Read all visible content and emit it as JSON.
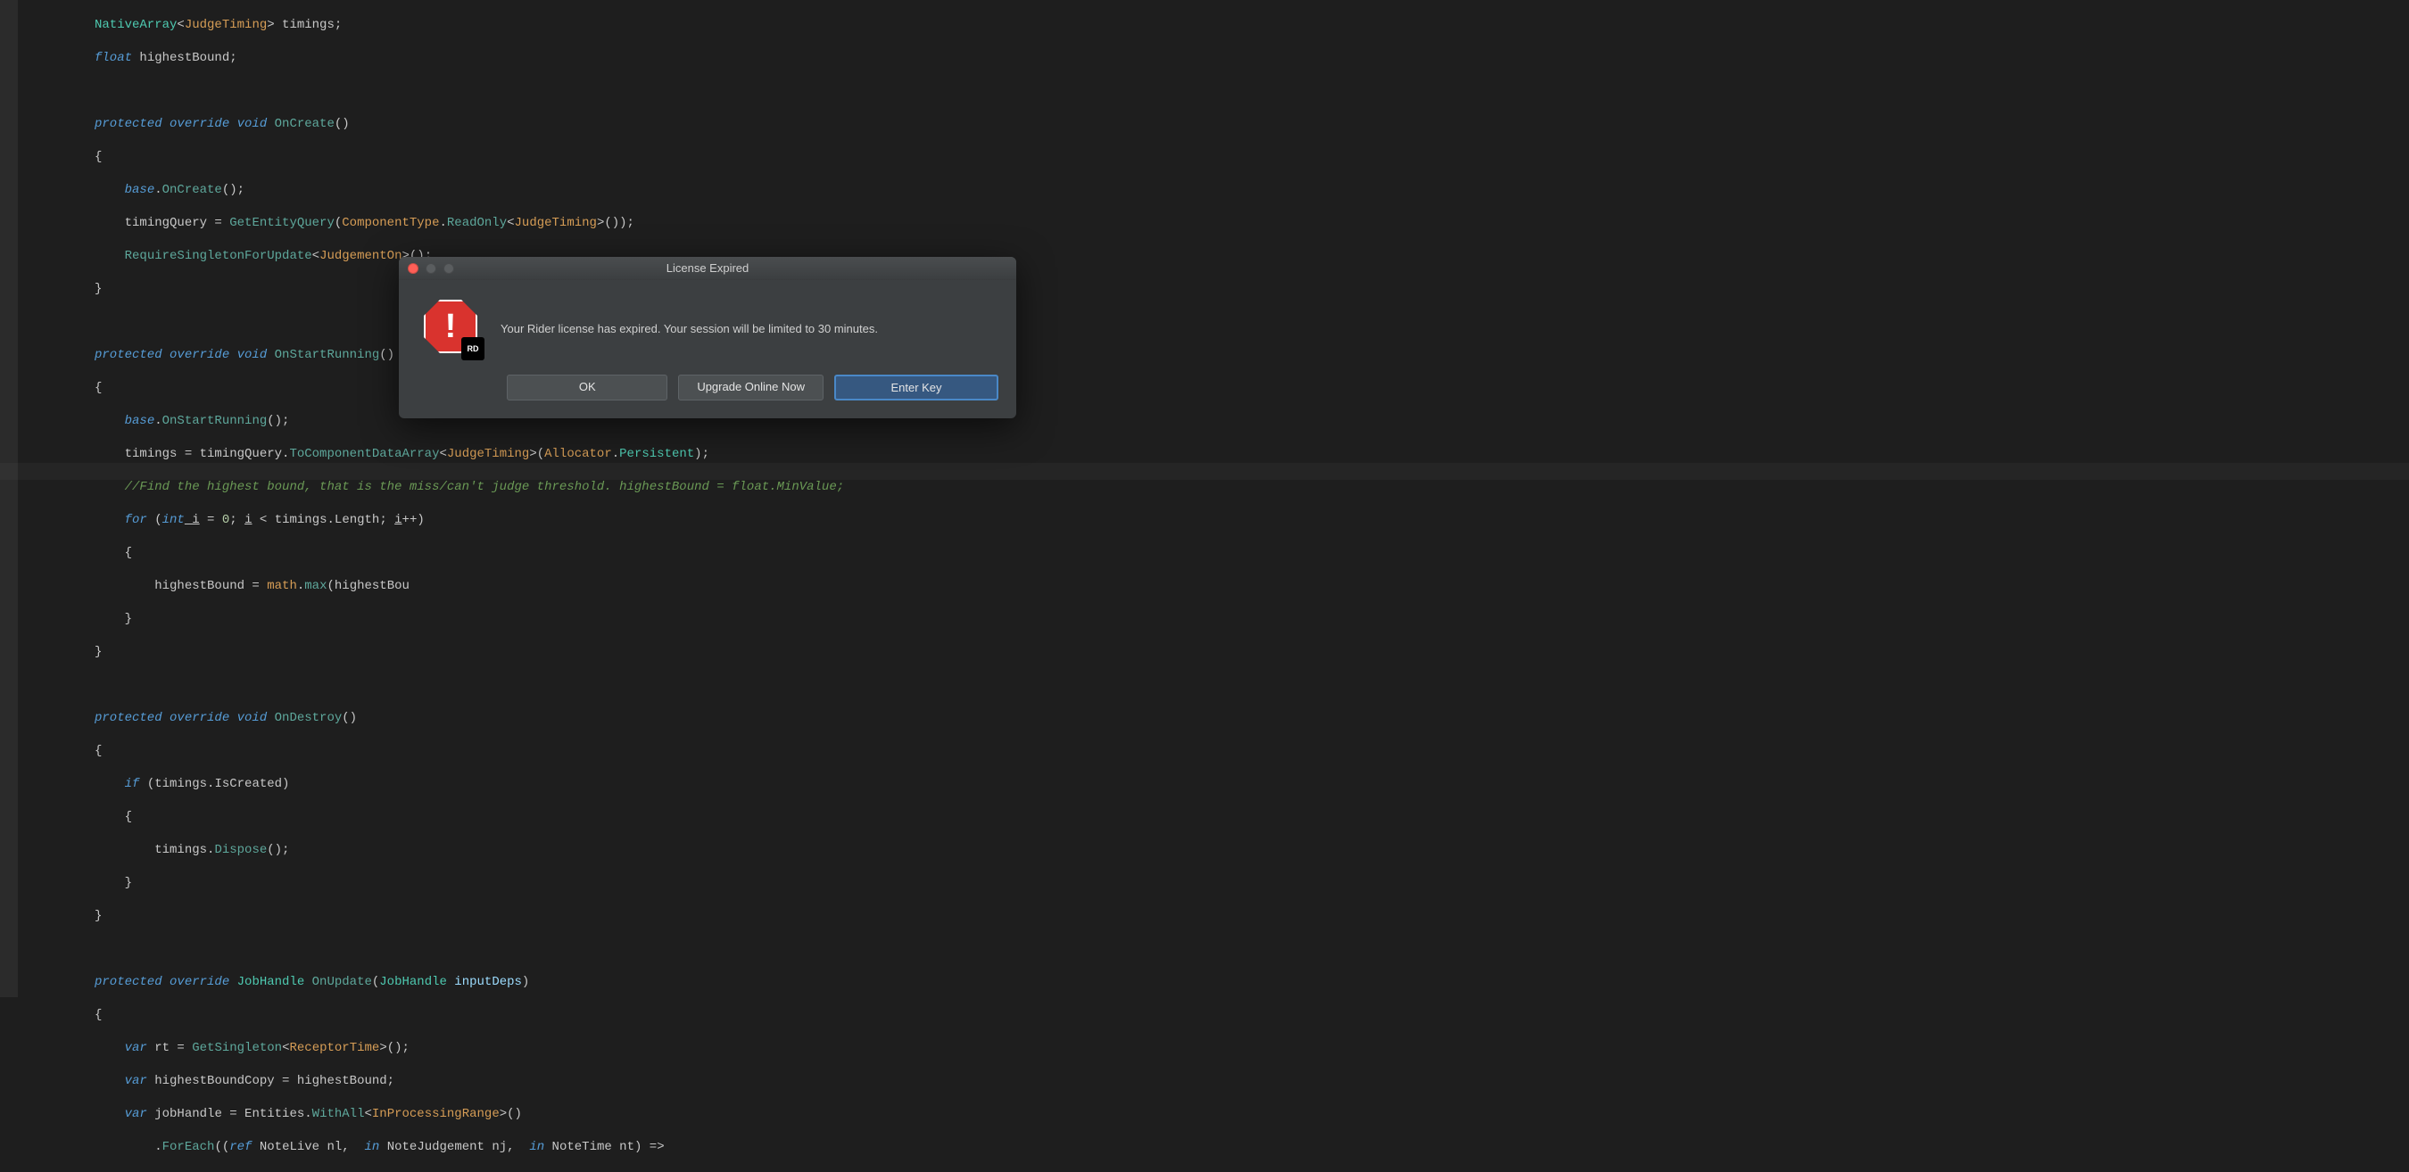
{
  "code": {
    "l1_a": "NativeArray",
    "l1_b": "JudgeTiming",
    "l1_c": "> timings;",
    "l2_a": "float",
    "l2_b": " highestBound;",
    "l4_a": "protected override void ",
    "l4_b": "OnCreate",
    "l4_c": "()",
    "l6_a": "base",
    "l6_b": ".",
    "l6_c": "OnCreate",
    "l6_d": "();",
    "l7_a": "timingQuery = ",
    "l7_b": "GetEntityQuery",
    "l7_c": "(",
    "l7_d": "ComponentType",
    "l7_e": ".",
    "l7_f": "ReadOnly",
    "l7_g": "<",
    "l7_h": "JudgeTiming",
    "l7_i": ">());",
    "l8_a": "RequireSingletonForUpdate",
    "l8_b": "<",
    "l8_c": "JudgementOn",
    "l8_d": ">();",
    "l11_a": "protected override void ",
    "l11_b": "OnStartRunning",
    "l11_c": "()",
    "l13_a": "base",
    "l13_b": ".",
    "l13_c": "OnStartRunning",
    "l13_d": "();",
    "l14_a": "timings = timingQuery.",
    "l14_b": "ToComponentDataArray",
    "l14_c": "<",
    "l14_d": "JudgeTiming",
    "l14_e": ">(",
    "l14_f": "Allocator",
    "l14_g": ".",
    "l14_h": "Persistent",
    "l14_i": ");",
    "l15": "//Find the highest bound, that is the miss/can't judge threshold. highestBound = float.MinValue;",
    "l16_a": "for ",
    "l16_b": "(",
    "l16_c": "int",
    "l16_d": " i",
    "l16_e": " = ",
    "l16_f": "0",
    "l16_g": "; ",
    "l16_h": "i",
    "l16_i": " < timings.Length; ",
    "l16_j": "i",
    "l16_k": "++)",
    "l18_a": "highestBound = ",
    "l18_b": "math",
    "l18_c": ".",
    "l18_d": "max",
    "l18_e": "(highestBou",
    "l22_a": "protected override void ",
    "l22_b": "OnDestroy",
    "l22_c": "()",
    "l24_a": "if ",
    "l24_b": "(timings.IsCreated)",
    "l26_a": "timings.",
    "l26_b": "Dispose",
    "l26_c": "();",
    "l30_a": "protected override ",
    "l30_b": "JobHandle ",
    "l30_c": "OnUpdate",
    "l30_d": "(",
    "l30_e": "JobHandle",
    "l30_f": " inputDeps",
    "l30_g": ")",
    "l32_a": "var",
    "l32_b": " rt = ",
    "l32_c": "GetSingleton",
    "l32_d": "<",
    "l32_e": "ReceptorTime",
    "l32_f": ">();",
    "l33_a": "var",
    "l33_b": " highestBoundCopy = highestBound;",
    "l34_a": "var",
    "l34_b": " jobHandle = Entities.",
    "l34_c": "WithAll",
    "l34_d": "<",
    "l34_e": "InProcessingRange",
    "l34_f": ">()",
    "l35_a": ".",
    "l35_b": "ForEach",
    "l35_c": "((",
    "l35_d": "ref",
    "l35_e": " NoteLive nl,  ",
    "l35_f": "in",
    "l35_g": " NoteJudgement nj,  ",
    "l35_h": "in",
    "l35_i": " NoteTime nt",
    "l35_j": ") =>",
    "brace_open": "{",
    "brace_close": "}"
  },
  "dialog": {
    "title": "License Expired",
    "message": "Your Rider license has expired. Your session will be limited to 30 minutes.",
    "badge": "RD",
    "buttons": {
      "ok": "OK",
      "upgrade": "Upgrade Online Now",
      "enter": "Enter Key"
    }
  }
}
